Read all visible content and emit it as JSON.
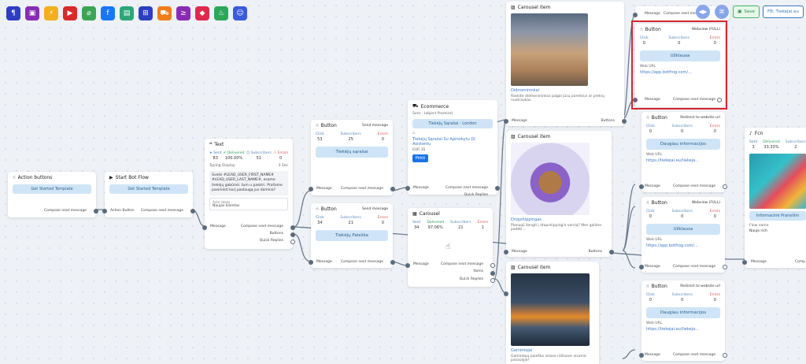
{
  "toolbar": {
    "icons": [
      {
        "name": "paragraph-icon",
        "glyph": "¶",
        "color": "#2f3ec0"
      },
      {
        "name": "card-icon",
        "glyph": "▣",
        "color": "#8a2bb5"
      },
      {
        "name": "flash-icon",
        "glyph": "⚡",
        "color": "#f2b01e"
      },
      {
        "name": "youtube-icon",
        "glyph": "▶",
        "color": "#d92a2a"
      },
      {
        "name": "attachment-icon",
        "glyph": "⌀",
        "color": "#3aa655"
      },
      {
        "name": "facebook-icon",
        "glyph": "f",
        "color": "#1877f2"
      },
      {
        "name": "contact-card-icon",
        "glyph": "▤",
        "color": "#2ea67a"
      },
      {
        "name": "sitemap-icon",
        "glyph": "⊞",
        "color": "#2b3fbf"
      },
      {
        "name": "cart-icon",
        "glyph": "⛟",
        "color": "#f07d1a"
      },
      {
        "name": "greater-than-icon",
        "glyph": "≥",
        "color": "#8a2bb5"
      },
      {
        "name": "paint-icon",
        "glyph": "◆",
        "color": "#e0284e"
      },
      {
        "name": "gas-icon",
        "glyph": "♨",
        "color": "#2ea65a"
      },
      {
        "name": "robot-icon",
        "glyph": "☺",
        "color": "#3b5bdb"
      }
    ]
  },
  "top": {
    "save": "Save",
    "fb_link": "FB: Tiekejai.eu",
    "nav_a": "◀▶",
    "nav_b": "⌘"
  },
  "common": {
    "compose": "Compose next message",
    "message": "Message",
    "buttons": "Buttons",
    "quick_replies": "Quick Replies",
    "items": "Items",
    "click": "Click",
    "subscribers": "Subscribers",
    "errors": "Errors",
    "sent": "Sent",
    "delivered": "Delivered",
    "send_message": "Send message",
    "web_url": "Web URL",
    "url_app": "https://app.botfrog.com/...",
    "url_tiek": "https://tiekejai.eu/tiekeja...",
    "webview_full": "Webview (FULL)",
    "redirect": "Redirect to website url"
  },
  "action": {
    "title": "Action buttons",
    "btn": "Get Started Template",
    "foot": "Compose next message"
  },
  "start": {
    "title": "Start Bot Flow",
    "btn": "Get Started Template",
    "in": "Action Button",
    "foot": "Compose next message"
  },
  "text": {
    "title": "Text",
    "sent": "83",
    "delivered": "100.00%",
    "subscribers": "51",
    "errors": "0",
    "typing": "Typing Display",
    "typing_val": "3 Sec",
    "body": "Sveiki #LEAD_USER_FIRST_NAME# #LEAD_USER_LAST_NAME#, esame tiekėjų gabūnėi. tum u paskiri. Prašome pasirinkti kurį paslaugą jus domina?",
    "field_label": "Auto labels",
    "field_value": "Naujas klientas"
  },
  "button1": {
    "title": "Button",
    "click": "53",
    "subs": "25",
    "err": "0",
    "btn": "Tiekėjų sąrašai"
  },
  "button2": {
    "title": "Button",
    "click": "34",
    "subs": "21",
    "err": "0",
    "btn": "Tiekėjų Paieška"
  },
  "ecommerce": {
    "title": "Ecommerce",
    "sent": "Sent - (object Promise)",
    "btn": "Tiekėjų Sąrašai - London",
    "product": "Tiekėjų Sąrašai Su Apmokytu DI Asistentu",
    "price": "EUR 35",
    "buy": "Pirkti"
  },
  "carousel": {
    "title": "Carousel",
    "sent": "34",
    "delivered": "97.06%",
    "subs": "21",
    "err": "1"
  },
  "citem1": {
    "title": "Carousel item",
    "name": "Didmenininkai",
    "desc": "Raskite didmenininkus pagal jūsų poreikius ar prekių nuotraukas"
  },
  "citem2": {
    "title": "Carousel item",
    "name": "Dropshippingas",
    "desc": "Planuoji žengti į dropshipping'o verslą? Mes galime padėti..."
  },
  "citem3": {
    "title": "Carousel item",
    "name": "Gamintojai",
    "desc": "Gamintojų paieška visose rūšiuose visame pasaulyje!"
  },
  "rb1": {
    "title": "Button",
    "click": "0",
    "subs": "0",
    "err": "0",
    "btn": "Užklausa"
  },
  "rb2": {
    "title": "Button",
    "click": "0",
    "subs": "0",
    "err": "0",
    "btn": "Daugiau informacijos"
  },
  "rb3": {
    "title": "Button",
    "click": "0",
    "subs": "0",
    "err": "0",
    "btn": "Užklausa"
  },
  "rb4": {
    "title": "Button",
    "click": "0",
    "subs": "0",
    "err": "0",
    "btn": "Daugiau informacijos"
  },
  "fcn": {
    "title": "Fcn",
    "sent": "3",
    "delivered": "33.33%",
    "subs": "2",
    "btn": "Informacinė Pranešim",
    "flow_label": "Flow name",
    "flow_value": "Naujo rich"
  }
}
